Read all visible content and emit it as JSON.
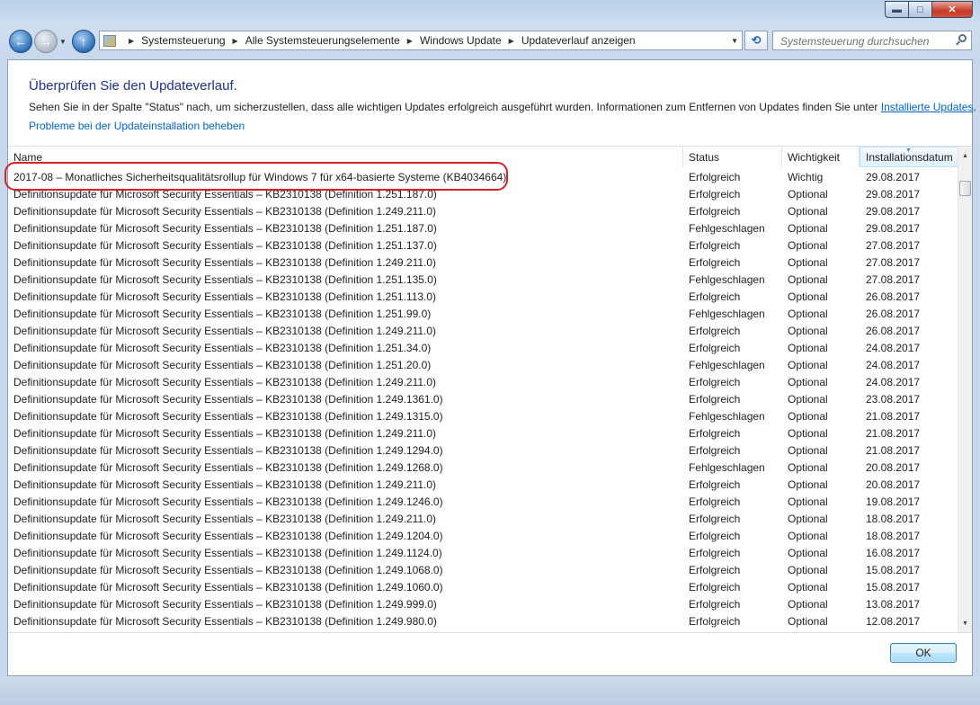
{
  "window": {
    "buttons": {
      "minimize": "▬",
      "maximize": "□",
      "close": "✕"
    }
  },
  "addressbar": {
    "crumbs": [
      "Systemsteuerung",
      "Alle Systemsteuerungselemente",
      "Windows Update",
      "Updateverlauf anzeigen"
    ]
  },
  "search": {
    "placeholder": "Systemsteuerung durchsuchen"
  },
  "page": {
    "title": "Überprüfen Sie den Updateverlauf.",
    "description": "Sehen Sie in der Spalte \"Status\" nach, um sicherzustellen, dass alle wichtigen Updates erfolgreich ausgeführt wurden. Informationen zum Entfernen von Updates finden Sie unter ",
    "installed_link": "Installierte Updates",
    "description_end": ".",
    "help_link": "Probleme bei der Updateinstallation beheben"
  },
  "columns": {
    "name": "Name",
    "status": "Status",
    "importance": "Wichtigkeit",
    "date": "Installationsdatum"
  },
  "rows": [
    {
      "name": "2017-08 – Monatliches Sicherheitsqualitätsrollup für Windows 7 für x64-basierte Systeme (KB4034664)",
      "status": "Erfolgreich",
      "importance": "Wichtig",
      "date": "29.08.2017"
    },
    {
      "name": "Definitionsupdate für Microsoft Security Essentials – KB2310138 (Definition 1.251.187.0)",
      "status": "Erfolgreich",
      "importance": "Optional",
      "date": "29.08.2017"
    },
    {
      "name": "Definitionsupdate für Microsoft Security Essentials – KB2310138 (Definition 1.249.211.0)",
      "status": "Erfolgreich",
      "importance": "Optional",
      "date": "29.08.2017"
    },
    {
      "name": "Definitionsupdate für Microsoft Security Essentials – KB2310138 (Definition 1.251.187.0)",
      "status": "Fehlgeschlagen",
      "importance": "Optional",
      "date": "29.08.2017"
    },
    {
      "name": "Definitionsupdate für Microsoft Security Essentials – KB2310138 (Definition 1.251.137.0)",
      "status": "Erfolgreich",
      "importance": "Optional",
      "date": "27.08.2017"
    },
    {
      "name": "Definitionsupdate für Microsoft Security Essentials – KB2310138 (Definition 1.249.211.0)",
      "status": "Erfolgreich",
      "importance": "Optional",
      "date": "27.08.2017"
    },
    {
      "name": "Definitionsupdate für Microsoft Security Essentials – KB2310138 (Definition 1.251.135.0)",
      "status": "Fehlgeschlagen",
      "importance": "Optional",
      "date": "27.08.2017"
    },
    {
      "name": "Definitionsupdate für Microsoft Security Essentials – KB2310138 (Definition 1.251.113.0)",
      "status": "Erfolgreich",
      "importance": "Optional",
      "date": "26.08.2017"
    },
    {
      "name": "Definitionsupdate für Microsoft Security Essentials – KB2310138 (Definition 1.251.99.0)",
      "status": "Fehlgeschlagen",
      "importance": "Optional",
      "date": "26.08.2017"
    },
    {
      "name": "Definitionsupdate für Microsoft Security Essentials – KB2310138 (Definition 1.249.211.0)",
      "status": "Erfolgreich",
      "importance": "Optional",
      "date": "26.08.2017"
    },
    {
      "name": "Definitionsupdate für Microsoft Security Essentials – KB2310138 (Definition 1.251.34.0)",
      "status": "Erfolgreich",
      "importance": "Optional",
      "date": "24.08.2017"
    },
    {
      "name": "Definitionsupdate für Microsoft Security Essentials – KB2310138 (Definition 1.251.20.0)",
      "status": "Fehlgeschlagen",
      "importance": "Optional",
      "date": "24.08.2017"
    },
    {
      "name": "Definitionsupdate für Microsoft Security Essentials – KB2310138 (Definition 1.249.211.0)",
      "status": "Erfolgreich",
      "importance": "Optional",
      "date": "24.08.2017"
    },
    {
      "name": "Definitionsupdate für Microsoft Security Essentials – KB2310138 (Definition 1.249.1361.0)",
      "status": "Erfolgreich",
      "importance": "Optional",
      "date": "23.08.2017"
    },
    {
      "name": "Definitionsupdate für Microsoft Security Essentials – KB2310138 (Definition 1.249.1315.0)",
      "status": "Fehlgeschlagen",
      "importance": "Optional",
      "date": "21.08.2017"
    },
    {
      "name": "Definitionsupdate für Microsoft Security Essentials – KB2310138 (Definition 1.249.211.0)",
      "status": "Erfolgreich",
      "importance": "Optional",
      "date": "21.08.2017"
    },
    {
      "name": "Definitionsupdate für Microsoft Security Essentials – KB2310138 (Definition 1.249.1294.0)",
      "status": "Erfolgreich",
      "importance": "Optional",
      "date": "21.08.2017"
    },
    {
      "name": "Definitionsupdate für Microsoft Security Essentials – KB2310138 (Definition 1.249.1268.0)",
      "status": "Fehlgeschlagen",
      "importance": "Optional",
      "date": "20.08.2017"
    },
    {
      "name": "Definitionsupdate für Microsoft Security Essentials – KB2310138 (Definition 1.249.211.0)",
      "status": "Erfolgreich",
      "importance": "Optional",
      "date": "20.08.2017"
    },
    {
      "name": "Definitionsupdate für Microsoft Security Essentials – KB2310138 (Definition 1.249.1246.0)",
      "status": "Erfolgreich",
      "importance": "Optional",
      "date": "19.08.2017"
    },
    {
      "name": "Definitionsupdate für Microsoft Security Essentials – KB2310138 (Definition 1.249.211.0)",
      "status": "Erfolgreich",
      "importance": "Optional",
      "date": "18.08.2017"
    },
    {
      "name": "Definitionsupdate für Microsoft Security Essentials – KB2310138 (Definition 1.249.1204.0)",
      "status": "Erfolgreich",
      "importance": "Optional",
      "date": "18.08.2017"
    },
    {
      "name": "Definitionsupdate für Microsoft Security Essentials – KB2310138 (Definition 1.249.1124.0)",
      "status": "Erfolgreich",
      "importance": "Optional",
      "date": "16.08.2017"
    },
    {
      "name": "Definitionsupdate für Microsoft Security Essentials – KB2310138 (Definition 1.249.1068.0)",
      "status": "Erfolgreich",
      "importance": "Optional",
      "date": "15.08.2017"
    },
    {
      "name": "Definitionsupdate für Microsoft Security Essentials – KB2310138 (Definition 1.249.1060.0)",
      "status": "Erfolgreich",
      "importance": "Optional",
      "date": "15.08.2017"
    },
    {
      "name": "Definitionsupdate für Microsoft Security Essentials – KB2310138 (Definition 1.249.999.0)",
      "status": "Erfolgreich",
      "importance": "Optional",
      "date": "13.08.2017"
    },
    {
      "name": "Definitionsupdate für Microsoft Security Essentials – KB2310138 (Definition 1.249.980.0)",
      "status": "Erfolgreich",
      "importance": "Optional",
      "date": "12.08.2017"
    }
  ],
  "ok_label": "OK",
  "colors": {
    "highlight_outline": "#d4202a",
    "link": "#0066cc",
    "title": "#1e3287"
  }
}
